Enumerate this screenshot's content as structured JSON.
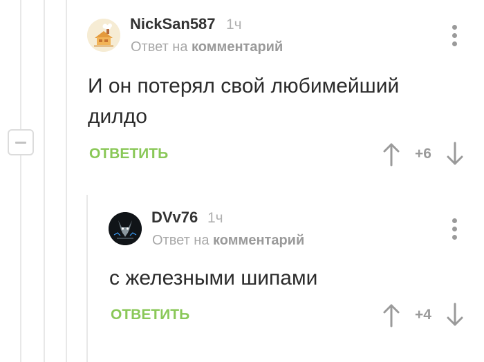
{
  "comments": [
    {
      "author": "NickSan587",
      "time": "1ч",
      "reply_prefix": "Ответ на",
      "reply_target": "комментарий",
      "body_line1": "И он потерял свой любимейший",
      "body_line2": "дилдо",
      "reply_label": "ОТВЕТИТЬ",
      "rating": "+6",
      "avatar_icon": "cottage-avatar-icon"
    },
    {
      "author": "DVv76",
      "time": "1ч",
      "reply_prefix": "Ответ на",
      "reply_target": "комментарий",
      "body_line1": "с железными шипами",
      "reply_label": "ОТВЕТИТЬ",
      "rating": "+4",
      "avatar_icon": "wolf-avatar-icon"
    }
  ],
  "icons": {
    "vote_up": "arrow-up-icon",
    "vote_down": "arrow-down-icon",
    "more": "more-vertical-icon",
    "collapse": "minus-icon"
  },
  "colors": {
    "reply_green": "#8ac858",
    "author_text": "#333333",
    "muted_text": "#a8a8a8",
    "thread_line": "#e8e8e8"
  }
}
